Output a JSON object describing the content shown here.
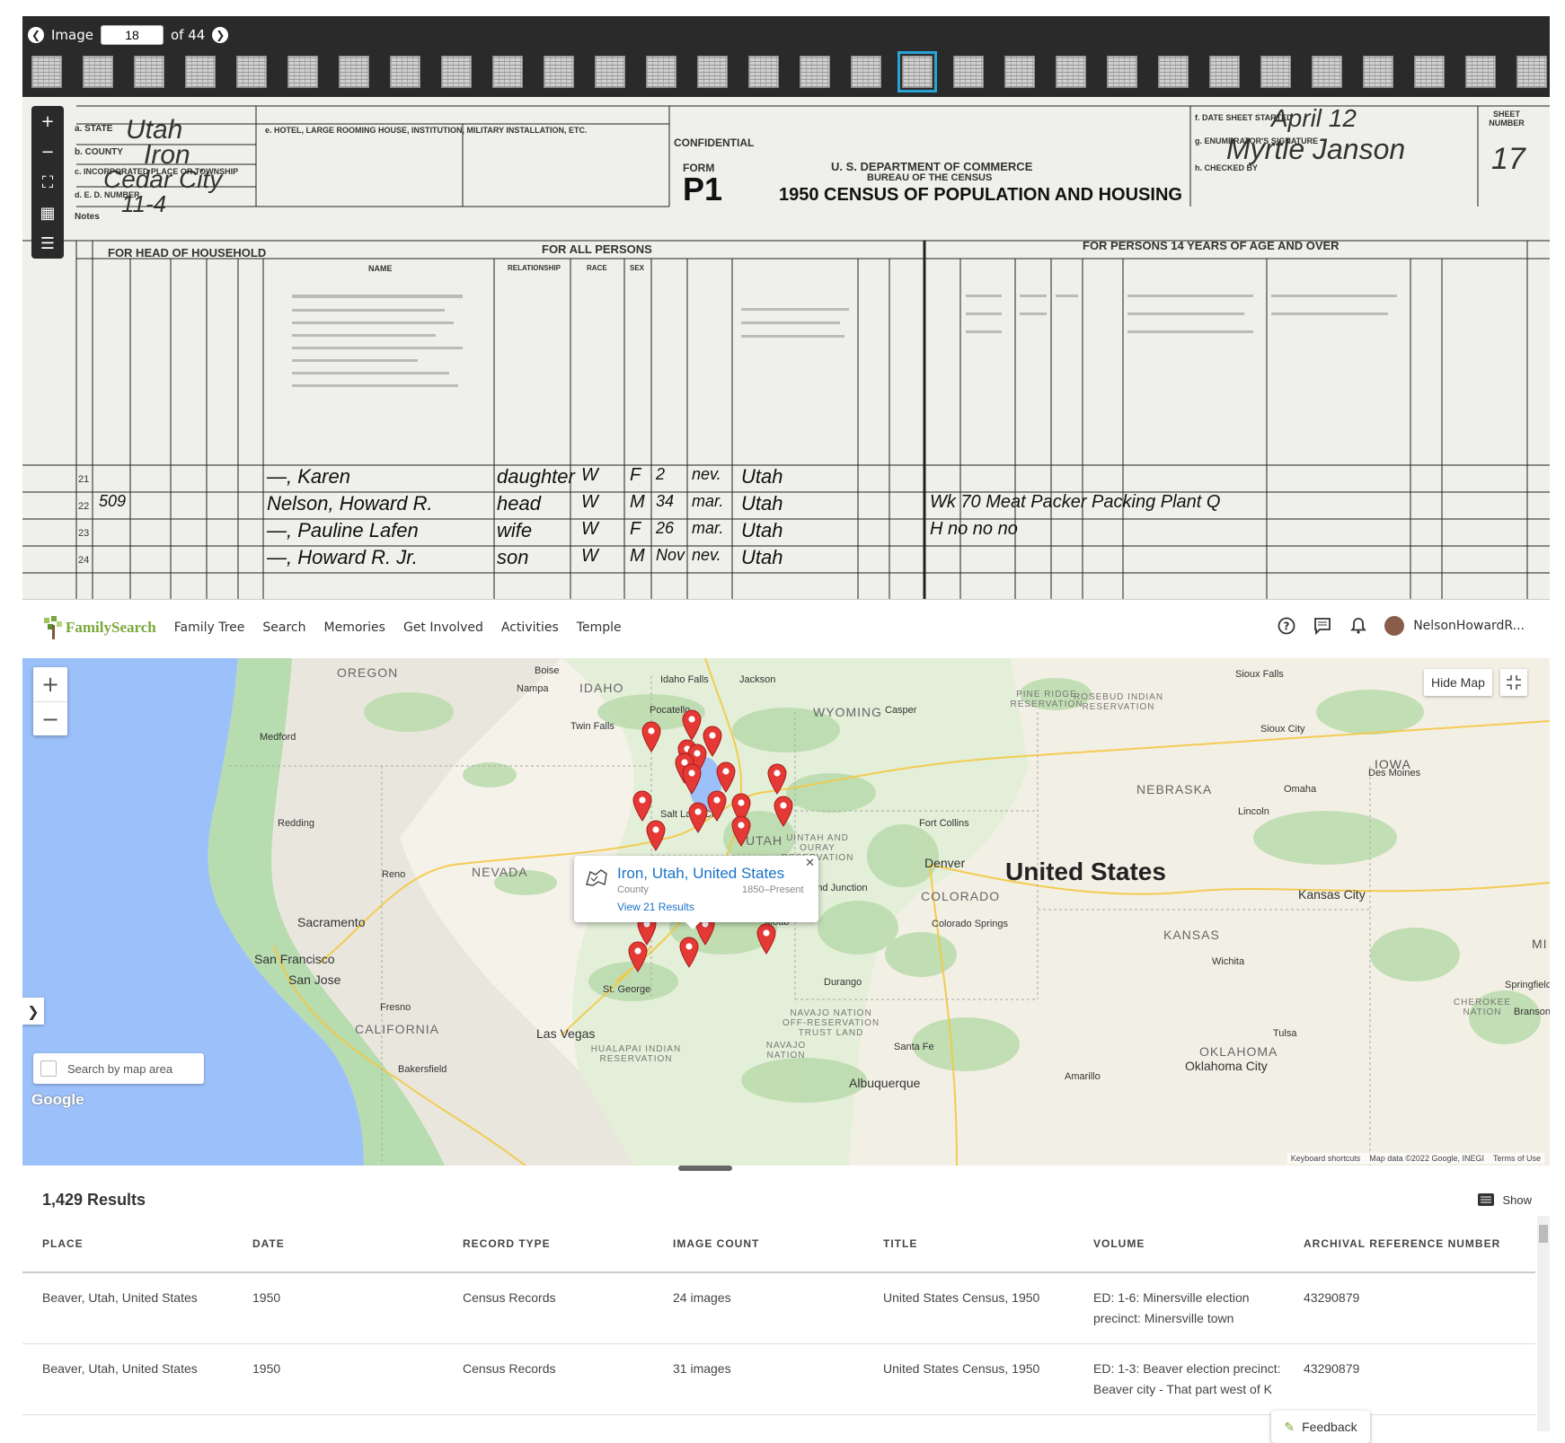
{
  "viewer": {
    "image_label": "Image",
    "image_number": "18",
    "of_label": "of 44",
    "thumb_count": 30,
    "selected_thumb": 17,
    "tools": [
      "plus-icon",
      "minus-icon",
      "fullscreen-icon",
      "grid-icon",
      "settings-icon"
    ]
  },
  "document": {
    "state_label": "a. STATE",
    "state_value": "Utah",
    "county_label": "b. COUNTY",
    "county_value": "Iron",
    "place_label": "c. INCORPORATED PLACE OR TOWNSHIP",
    "place_value": "Cedar City",
    "ed_label": "d. E. D. NUMBER",
    "ed_value": "11-4",
    "notes_label": "Notes",
    "hotel_label": "e. HOTEL, LARGE ROOMING HOUSE, INSTITUTION, MILITARY INSTALLATION, ETC.",
    "confidential": "CONFIDENTIAL",
    "form_label": "FORM",
    "form_number": "P1",
    "dept": "U. S. DEPARTMENT OF COMMERCE",
    "bureau": "BUREAU OF THE CENSUS",
    "census_title": "1950 CENSUS OF POPULATION AND HOUSING",
    "date_label": "f. DATE SHEET STARTED",
    "date_value": "April 12",
    "enumerator_label": "g. ENUMERATOR'S SIGNATURE",
    "enumerator_value": "Myrtle Janson",
    "checked_label": "h. CHECKED BY",
    "sheet_label": "SHEET NUMBER",
    "sheet_value": "17",
    "head_section": "FOR HEAD OF HOUSEHOLD",
    "all_section": "FOR ALL PERSONS",
    "fourteen_section": "FOR PERSONS 14 YEARS OF AGE AND OVER",
    "name_header": "NAME",
    "relationship_header": "RELATIONSHIP",
    "race_header": "RACE",
    "sex_header": "SEX",
    "rows": [
      {
        "line": "21",
        "name": "—, Karen",
        "rel": "daughter",
        "race": "W",
        "sex": "F",
        "age": "2",
        "marital": "nev.",
        "birth": "Utah",
        "extra": ""
      },
      {
        "line": "22",
        "num": "509",
        "name": "Nelson, Howard R.",
        "rel": "head",
        "race": "W",
        "sex": "M",
        "age": "34",
        "marital": "mar.",
        "birth": "Utah",
        "extra": "Wk   70  Meat Packer   Packing Plant  Q"
      },
      {
        "line": "23",
        "name": "—, Pauline Lafen",
        "rel": "wife",
        "race": "W",
        "sex": "F",
        "age": "26",
        "marital": "mar.",
        "birth": "Utah",
        "extra": "H   no   no   no"
      },
      {
        "line": "24",
        "name": "—, Howard R. Jr.",
        "rel": "son",
        "race": "W",
        "sex": "M",
        "age": "Nov",
        "marital": "nev.",
        "birth": "Utah",
        "extra": ""
      }
    ]
  },
  "header": {
    "logo_text": "FamilySearch",
    "menu": [
      "Family Tree",
      "Search",
      "Memories",
      "Get Involved",
      "Activities",
      "Temple"
    ],
    "username": "NelsonHowardR..."
  },
  "map": {
    "zoom_in": "+",
    "zoom_out": "−",
    "hide_map": "Hide Map",
    "search_area": "Search by map area",
    "google": "Google",
    "attribution": [
      "Keyboard shortcuts",
      "Map data ©2022 Google, INEGI",
      "Terms of Use"
    ],
    "popup": {
      "title": "Iron, Utah, United States",
      "type": "County",
      "dates": "1850–Present",
      "link": "View 21 Results"
    },
    "labels": {
      "states": [
        "OREGON",
        "IDAHO",
        "WYOMING",
        "NEBRASKA",
        "IOWA",
        "NEVADA",
        "COLORADO",
        "KANSAS",
        "CALIFORNIA",
        "OKLAHOMA",
        "UTAH",
        "MI"
      ],
      "country": "United States",
      "cities": [
        "Boise",
        "Nampa",
        "Idaho Falls",
        "Jackson",
        "Pocatello",
        "Twin Falls",
        "Casper",
        "Sioux Falls",
        "Medford",
        "Redding",
        "Reno",
        "Sacramento",
        "San Francisco",
        "San Jose",
        "Fresno",
        "Bakersfield",
        "Las Vegas",
        "St. George",
        "Salt Lake City",
        "Moab",
        "Grand Junction",
        "Durango",
        "Santa Fe",
        "Albuquerque",
        "Amarillo",
        "Denver",
        "Fort Collins",
        "Colorado Springs",
        "Omaha",
        "Lincoln",
        "Des Moines",
        "Sioux City",
        "Kansas City",
        "Wichita",
        "Tulsa",
        "Oklahoma City",
        "Springfield",
        "Branson"
      ],
      "reservations": [
        "PINE RIDGE RESERVATION",
        "ROSEBUD INDIAN RESERVATION",
        "UINTAH AND OURAY RESERVATION",
        "NAVAJO NATION OFF-RESERVATION TRUST LAND",
        "NAVAJO NATION",
        "HUALAPAI INDIAN RESERVATION",
        "CHEROKEE NATION"
      ]
    }
  },
  "results": {
    "count": "1,429 Results",
    "show": "Show",
    "columns": [
      "PLACE",
      "DATE",
      "RECORD TYPE",
      "IMAGE COUNT",
      "TITLE",
      "VOLUME",
      "ARCHIVAL REFERENCE NUMBER"
    ],
    "rows": [
      [
        "Beaver, Utah, United States",
        "1950",
        "Census Records",
        "24 images",
        "United States Census, 1950",
        "ED: 1-6: Minersville election precinct: Minersville town",
        "43290879"
      ],
      [
        "Beaver, Utah, United States",
        "1950",
        "Census Records",
        "31 images",
        "United States Census, 1950",
        "ED: 1-3: Beaver election precinct: Beaver city - That part west of K",
        "43290879"
      ]
    ]
  },
  "feedback": "Feedback",
  "colors": {
    "brand_green": "#7aa83b",
    "link_blue": "#1a73c8",
    "pin_red": "#e53935",
    "viewer_dark": "#2a2a2a",
    "thumb_selected": "#29a3d6"
  }
}
